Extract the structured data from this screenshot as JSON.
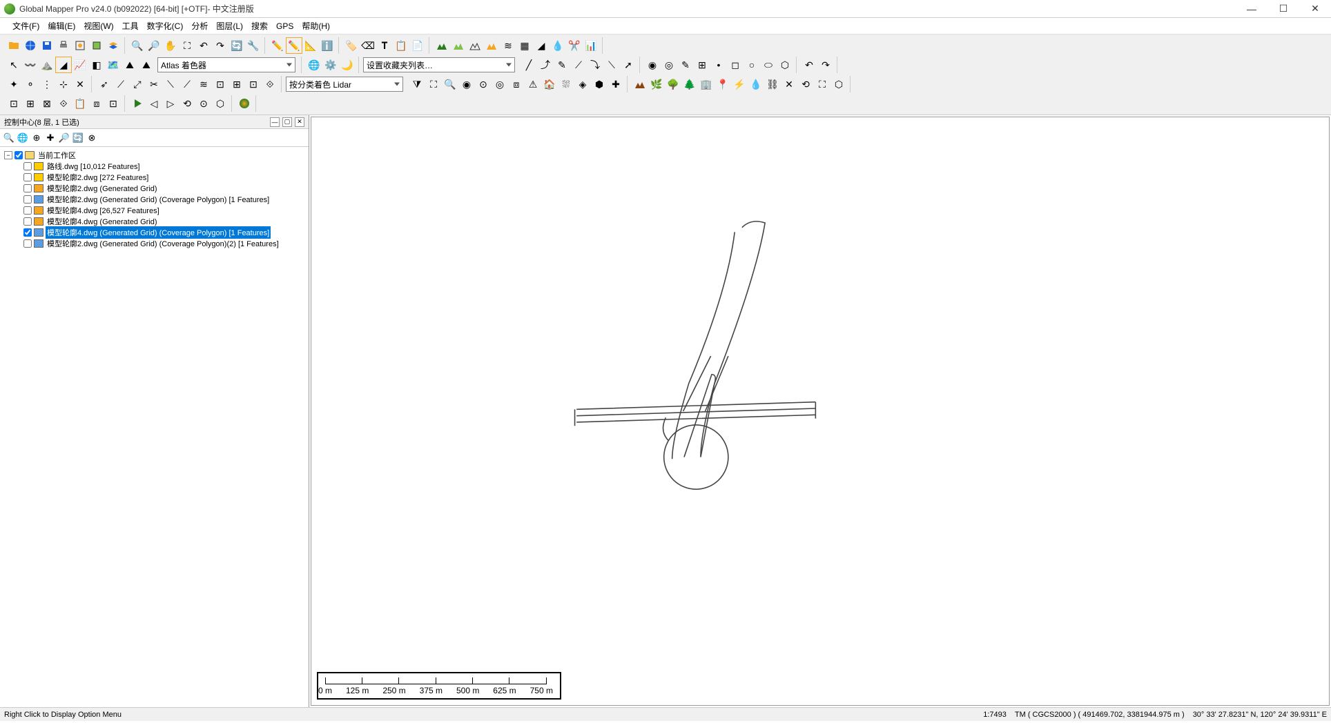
{
  "title": "Global Mapper Pro v24.0 (b092022) [64-bit] [+OTF]- 中文注册版",
  "menu": [
    "文件(F)",
    "编辑(E)",
    "视图(W)",
    "工具",
    "数字化(C)",
    "分析",
    "图层(L)",
    "搜索",
    "GPS",
    "帮助(H)"
  ],
  "panel": {
    "title": "控制中心(8 层, 1 已选)"
  },
  "dropdowns": {
    "shader": "Atlas 着色器",
    "favorites": "设置收藏夹列表…",
    "lidar": "按分类着色 Lidar"
  },
  "tree": {
    "root": "当前工作区",
    "items": [
      {
        "checked": false,
        "iconClass": "yellow",
        "label": "路线.dwg [10,012 Features]"
      },
      {
        "checked": false,
        "iconClass": "yellow",
        "label": "模型轮廓2.dwg [272 Features]"
      },
      {
        "checked": false,
        "iconClass": "orange",
        "label": "模型轮廓2.dwg (Generated Grid)"
      },
      {
        "checked": false,
        "iconClass": "blue",
        "label": "模型轮廓2.dwg (Generated Grid) (Coverage Polygon) [1 Features]"
      },
      {
        "checked": false,
        "iconClass": "orange",
        "label": "模型轮廓4.dwg [26,527 Features]"
      },
      {
        "checked": false,
        "iconClass": "orange",
        "label": "模型轮廓4.dwg (Generated Grid)"
      },
      {
        "checked": true,
        "iconClass": "blue",
        "label": "模型轮廓4.dwg (Generated Grid) (Coverage Polygon) [1 Features]",
        "selected": true
      },
      {
        "checked": false,
        "iconClass": "blue",
        "label": "模型轮廓2.dwg (Generated Grid) (Coverage Polygon)(2) [1 Features]"
      }
    ]
  },
  "scalebar": [
    "0 m",
    "125 m",
    "250 m",
    "375 m",
    "500 m",
    "625 m",
    "750 m"
  ],
  "status": {
    "left": "Right Click to Display Option Menu",
    "scale": "1:7493",
    "proj": "TM ( CGCS2000 ) ( 491469.702, 3381944.975 m )",
    "coords": "30° 33' 27.8231\" N, 120° 24' 39.9311\" E"
  }
}
